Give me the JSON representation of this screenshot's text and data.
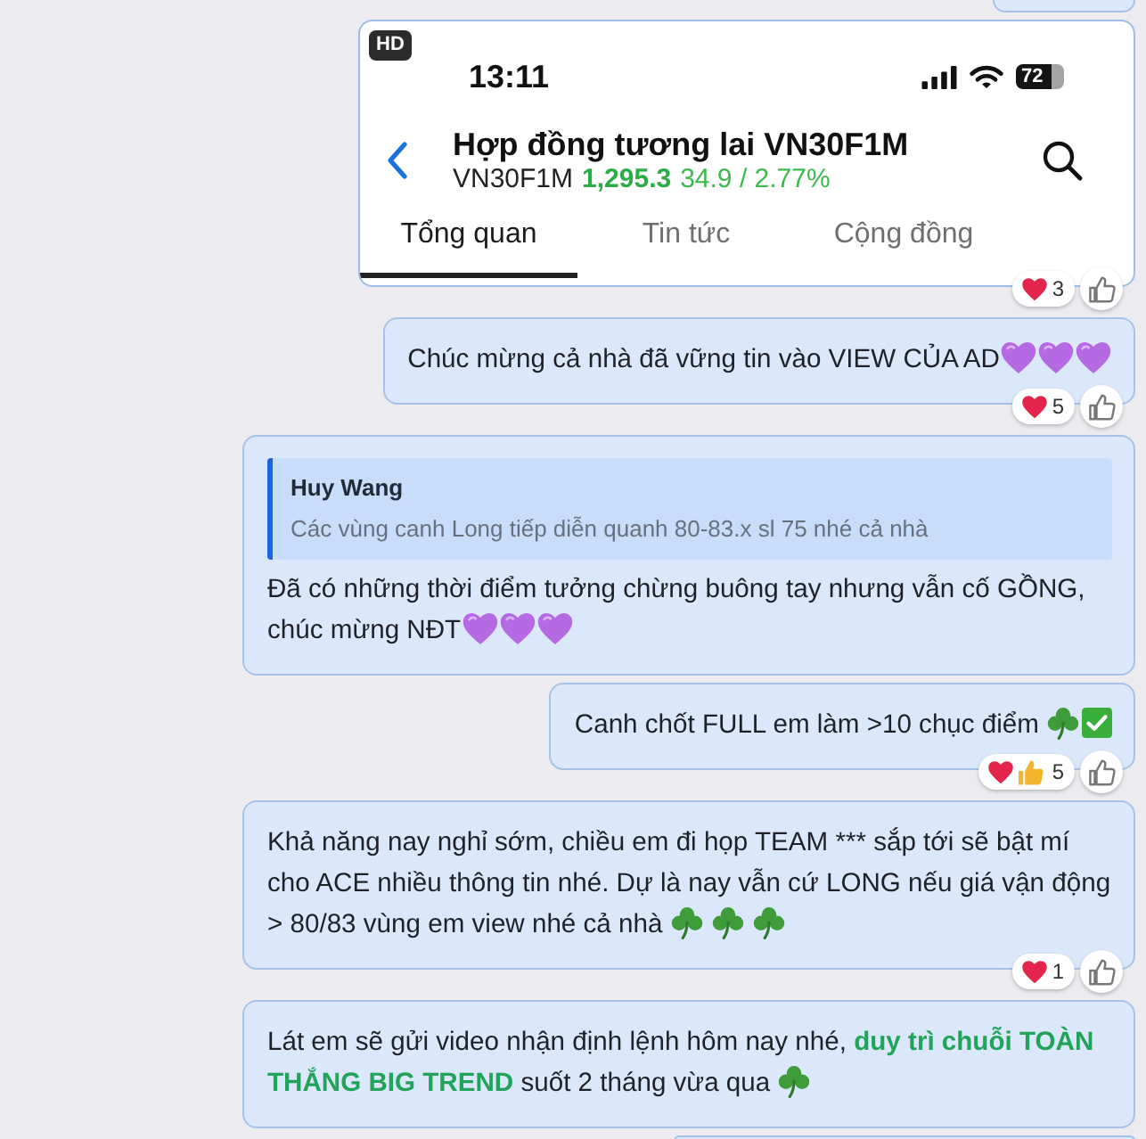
{
  "messages": [
    {
      "kind": "clipped_top"
    },
    {
      "kind": "image",
      "screenshot": {
        "badge": "HD",
        "time": "13:11",
        "battery": "72",
        "title": "Hợp đồng tương lai VN30F1M",
        "symbol": "VN30F1M",
        "price": "1,295.3",
        "change": "34.9 / 2.77%",
        "tabs": [
          {
            "label": "Tổng quan",
            "selected": true
          },
          {
            "label": "Tin tức",
            "selected": false
          },
          {
            "label": "Cộng đồng",
            "selected": false
          }
        ]
      },
      "reactions": {
        "icons": [
          {
            "kind": "heart"
          }
        ],
        "count": "3"
      }
    },
    {
      "kind": "text",
      "text": "Chúc mừng cả nhà đã vững tin vào VIEW CỦA AD",
      "emojis": [
        {
          "kind": "purple_heart"
        },
        {
          "kind": "purple_heart"
        },
        {
          "kind": "purple_heart"
        }
      ],
      "reactions": {
        "icons": [
          {
            "kind": "heart"
          }
        ],
        "count": "5"
      }
    },
    {
      "kind": "reply",
      "quote": {
        "author": "Huy Wang",
        "text": "Các vùng canh Long tiếp diễn quanh 80-83.x sl 75 nhé cả nhà"
      },
      "text": "Đã có những thời điểm tưởng chừng buông tay nhưng vẫn cố GỒNG, chúc mừng NĐT",
      "emojis": [
        {
          "kind": "purple_heart"
        },
        {
          "kind": "purple_heart"
        },
        {
          "kind": "purple_heart"
        }
      ]
    },
    {
      "kind": "text",
      "text": "Canh chốt FULL em làm >10 chục điểm",
      "emojis": [
        {
          "kind": "shamrock"
        },
        {
          "kind": "check"
        }
      ],
      "reactions": {
        "icons": [
          {
            "kind": "heart"
          },
          {
            "kind": "thumbs_up"
          }
        ],
        "count": "5"
      }
    },
    {
      "kind": "text",
      "text": "Khả năng nay nghỉ sớm, chiều em đi họp TEAM *** sắp tới sẽ bật mí cho ACE nhiều thông tin nhé. Dự là nay vẫn cứ LONG nếu giá vận động > 80/83 vùng em view nhé cả nhà",
      "emojis": [
        {
          "kind": "shamrock"
        },
        {
          "kind": "shamrock"
        },
        {
          "kind": "shamrock"
        }
      ],
      "reactions": {
        "icons": [
          {
            "kind": "heart"
          }
        ],
        "count": "1"
      }
    },
    {
      "kind": "text",
      "markup": "Lát em sẽ gửi video nhận định lệnh hôm nay nhé, **duy trì chuỗi TOÀN THẮNG BIG TREND** suốt 2 tháng vừa qua",
      "emojis": [
        {
          "kind": "shamrock"
        }
      ]
    },
    {
      "kind": "clipped_bottom"
    }
  ]
}
